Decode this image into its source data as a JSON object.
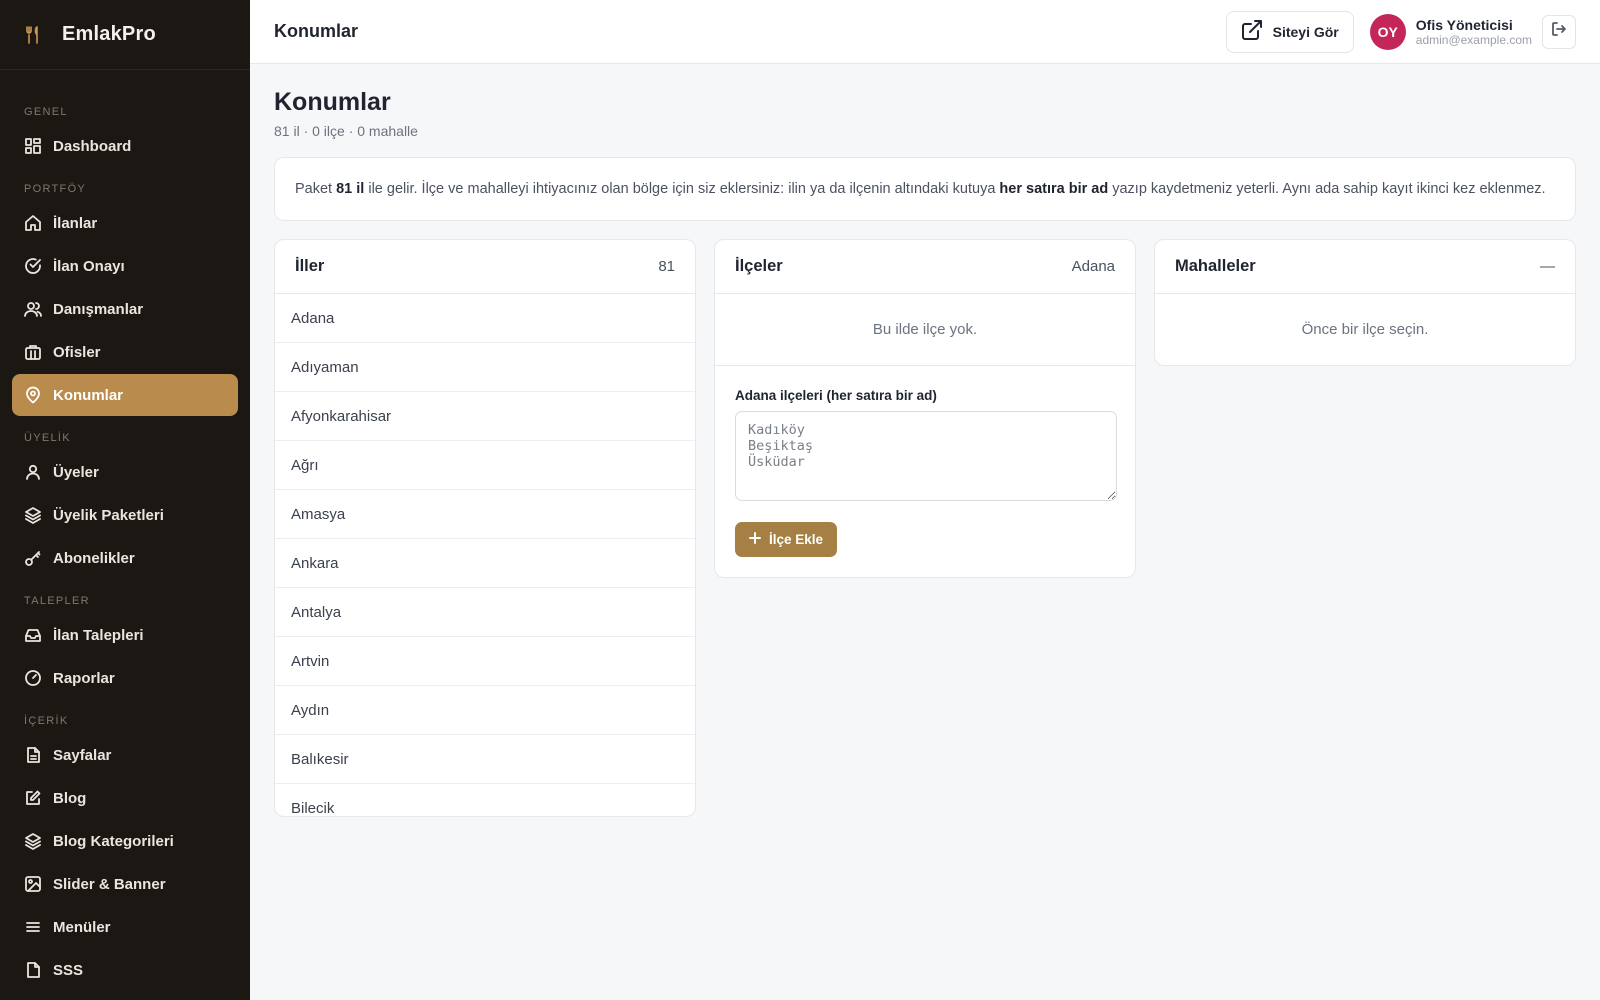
{
  "brand": {
    "name": "EmlakPro",
    "accent": "#b98c4d"
  },
  "sidebar": {
    "sections": [
      {
        "label": "GENEL",
        "items": [
          {
            "label": "Dashboard",
            "icon": "grid-icon"
          }
        ]
      },
      {
        "label": "PORTFÖY",
        "items": [
          {
            "label": "İlanlar",
            "icon": "home-icon"
          },
          {
            "label": "İlan Onayı",
            "icon": "check-circle-icon"
          },
          {
            "label": "Danışmanlar",
            "icon": "users-icon"
          },
          {
            "label": "Ofisler",
            "icon": "briefcase-icon"
          },
          {
            "label": "Konumlar",
            "icon": "map-pin-icon",
            "active": true
          }
        ]
      },
      {
        "label": "ÜYELİK",
        "items": [
          {
            "label": "Üyeler",
            "icon": "user-icon"
          },
          {
            "label": "Üyelik Paketleri",
            "icon": "layers-icon"
          },
          {
            "label": "Abonelikler",
            "icon": "key-icon"
          }
        ]
      },
      {
        "label": "TALEPLER",
        "items": [
          {
            "label": "İlan Talepleri",
            "icon": "inbox-icon"
          },
          {
            "label": "Raporlar",
            "icon": "gauge-icon"
          }
        ]
      },
      {
        "label": "İÇERİK",
        "items": [
          {
            "label": "Sayfalar",
            "icon": "file-icon"
          },
          {
            "label": "Blog",
            "icon": "edit-icon"
          },
          {
            "label": "Blog Kategorileri",
            "icon": "layers-icon"
          },
          {
            "label": "Slider & Banner",
            "icon": "image-icon"
          },
          {
            "label": "Menüler",
            "icon": "menu-icon"
          },
          {
            "label": "SSS",
            "icon": "file-icon"
          }
        ]
      }
    ]
  },
  "topbar": {
    "title": "Konumlar",
    "site_button": "Siteyi Gör",
    "avatar_initials": "OY",
    "user_name": "Ofis Yöneticisi",
    "user_email": "admin@example.com"
  },
  "page": {
    "title": "Konumlar",
    "subtitle": "81 il · 0 ilçe · 0 mahalle",
    "info": {
      "t1": "Paket ",
      "b1": "81 il",
      "t2": " ile gelir. İlçe ve mahalleyi ihtiyacınız olan bölge için siz eklersiniz: ilin ya da ilçenin altındaki kutuya ",
      "b2": "her satıra bir ad",
      "t3": " yazıp kaydetmeniz yeterli. Aynı ada sahip kayıt ikinci kez eklenmez."
    }
  },
  "provinces": {
    "title": "İller",
    "count": "81",
    "items": [
      "Adana",
      "Adıyaman",
      "Afyonkarahisar",
      "Ağrı",
      "Amasya",
      "Ankara",
      "Antalya",
      "Artvin",
      "Aydın",
      "Balıkesir",
      "Bilecik"
    ]
  },
  "districts": {
    "title": "İlçeler",
    "selected": "Adana",
    "empty": "Bu ilde ilçe yok.",
    "form_label": "Adana ilçeleri (her satıra bir ad)",
    "placeholder": "Kadıköy\nBeşiktaş\nÜsküdar",
    "add_button": "İlçe Ekle"
  },
  "neighborhoods": {
    "title": "Mahalleler",
    "selected": "—",
    "empty": "Önce bir ilçe seçin."
  }
}
